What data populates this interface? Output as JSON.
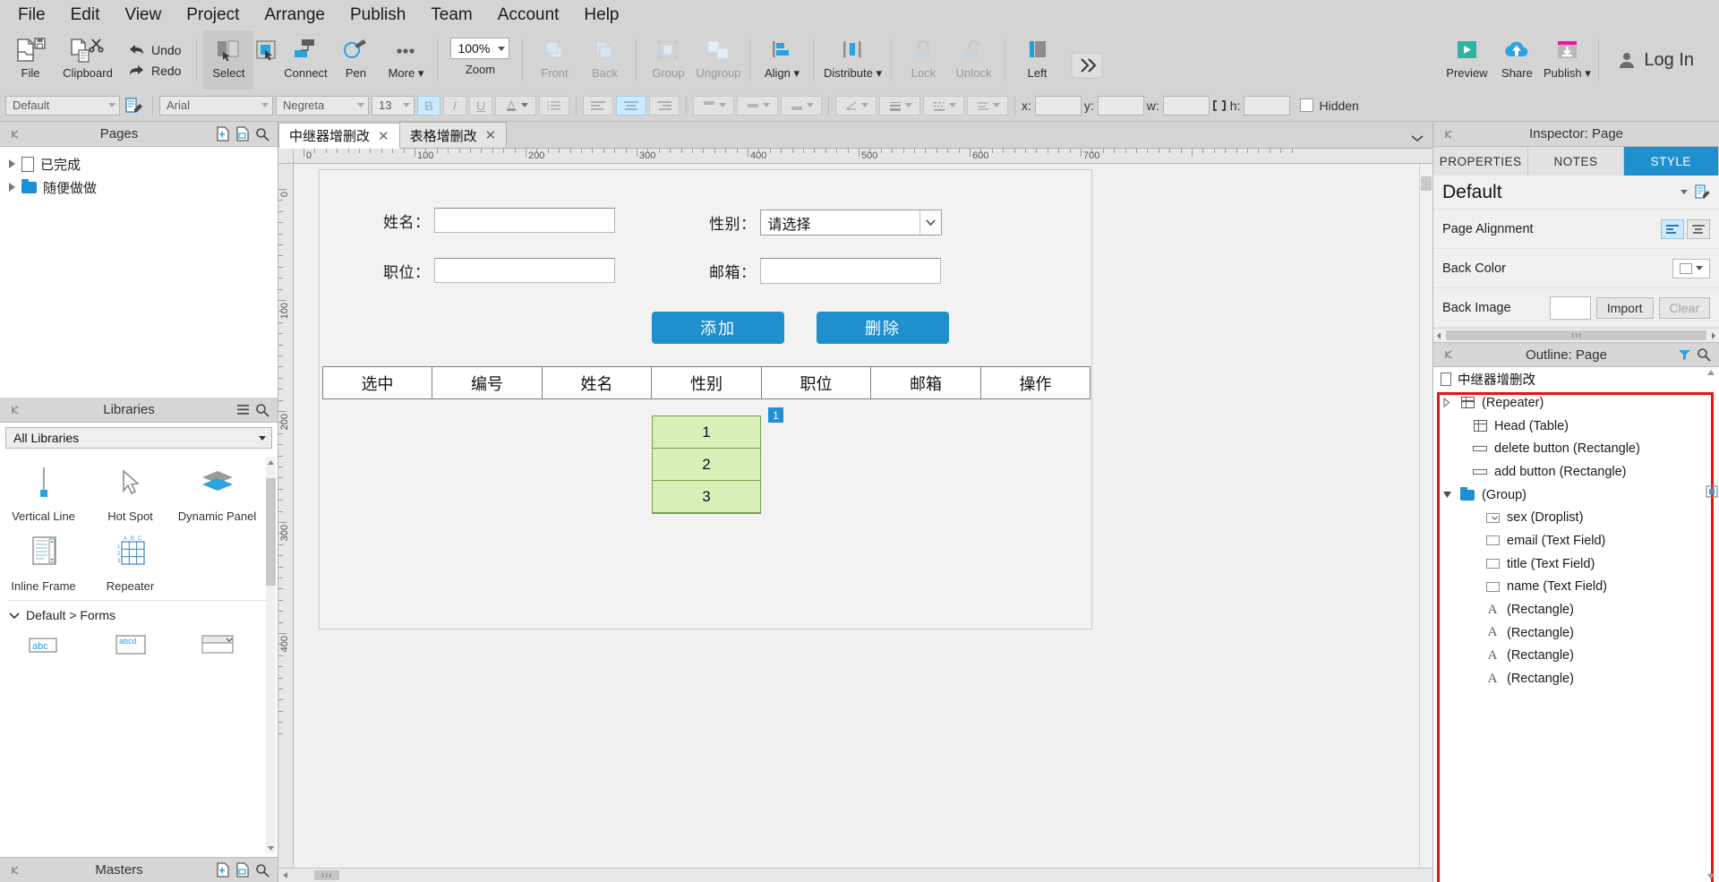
{
  "menu": [
    "File",
    "Edit",
    "View",
    "Project",
    "Arrange",
    "Publish",
    "Team",
    "Account",
    "Help"
  ],
  "toolbar": {
    "file": "File",
    "clipboard": "Clipboard",
    "undo": "Undo",
    "redo": "Redo",
    "select": "Select",
    "connect": "Connect",
    "pen": "Pen",
    "more": "More",
    "zoom_value": "100%",
    "zoom_label": "Zoom",
    "front": "Front",
    "back": "Back",
    "group": "Group",
    "ungroup": "Ungroup",
    "align": "Align",
    "distribute": "Distribute",
    "lock": "Lock",
    "unlock": "Unlock",
    "left": "Left",
    "overflow": "»",
    "preview": "Preview",
    "share": "Share",
    "publish": "Publish",
    "login": "Log In"
  },
  "format": {
    "style_preset": "Default",
    "font_family": "Arial",
    "font_weight": "Negreta",
    "font_size": "13",
    "bold": "B",
    "italic": "I",
    "underline": "U",
    "x_label": "x:",
    "y_label": "y:",
    "w_label": "w:",
    "h_label": "h:",
    "x_value": "",
    "y_value": "",
    "w_value": "",
    "h_value": "",
    "hidden_label": "Hidden"
  },
  "pages": {
    "title": "Pages",
    "items": [
      {
        "label": "已完成",
        "icon": "page-icon"
      },
      {
        "label": "随便做做",
        "icon": "folder-icon"
      }
    ]
  },
  "libraries": {
    "title": "Libraries",
    "selected": "All Libraries",
    "widgets_row1": [
      {
        "label": "Vertical Line",
        "icon": "vertical-line-icon"
      },
      {
        "label": "Hot Spot",
        "icon": "cursor-icon"
      },
      {
        "label": "Dynamic Panel",
        "icon": "layers-icon"
      }
    ],
    "widgets_row2": [
      {
        "label": "Inline Frame",
        "icon": "iframe-icon"
      },
      {
        "label": "Repeater",
        "icon": "repeater-icon"
      }
    ],
    "section": "Default > Forms",
    "widgets_row3": [
      {
        "label": "abc",
        "icon": "textfield-icon"
      },
      {
        "label": "abcd",
        "icon": "textarea-icon"
      },
      {
        "label": "",
        "icon": "droplist-icon"
      }
    ],
    "masters": "Masters"
  },
  "tabs": [
    {
      "label": "中继器增删改",
      "active": true
    },
    {
      "label": "表格增删改",
      "active": false
    }
  ],
  "ruler": {
    "h_labels": [
      "0",
      "100",
      "200",
      "300",
      "400",
      "500",
      "600",
      "700"
    ],
    "v_labels": [
      "0",
      "100",
      "200",
      "300",
      "400"
    ]
  },
  "canvas": {
    "form": {
      "fields": [
        {
          "label": "姓名：",
          "type": "text",
          "value": ""
        },
        {
          "label": "性别：",
          "type": "droplist",
          "value": "请选择"
        },
        {
          "label": "职位：",
          "type": "text",
          "value": ""
        },
        {
          "label": "邮箱：",
          "type": "text",
          "value": ""
        }
      ],
      "buttons": [
        {
          "label": "添加",
          "color": "#1f90cd"
        },
        {
          "label": "删除",
          "color": "#1f90cd"
        }
      ]
    },
    "table_headers": [
      "选中",
      "编号",
      "姓名",
      "性别",
      "职位",
      "邮箱",
      "操作"
    ],
    "repeater": {
      "rows": [
        "1",
        "2",
        "3"
      ],
      "badge": "1",
      "fill": "#d9efb8",
      "border": "#7b9f52"
    }
  },
  "inspector": {
    "title": "Inspector: Page",
    "tabs": [
      {
        "label": "PROPERTIES",
        "active": false
      },
      {
        "label": "NOTES",
        "active": false
      },
      {
        "label": "STYLE",
        "active": true
      }
    ],
    "style_name": "Default",
    "rows": [
      {
        "name": "Page Alignment",
        "control": "align-buttons"
      },
      {
        "name": "Back Color",
        "control": "color-picker"
      },
      {
        "name": "Back Image",
        "control": "image-import"
      }
    ],
    "import_label": "Import",
    "clear_label": "Clear"
  },
  "outline": {
    "title": "Outline: Page",
    "root": "中继器增删改",
    "items": [
      {
        "label": "(Repeater)",
        "icon": "table-icon",
        "indent": 0,
        "expander": "collapsed"
      },
      {
        "label": "Head (Table)",
        "icon": "table-icon",
        "indent": 1,
        "expander": "none"
      },
      {
        "label": "delete button (Rectangle)",
        "icon": "rectangle-icon",
        "indent": 1,
        "expander": "none"
      },
      {
        "label": "add button (Rectangle)",
        "icon": "rectangle-icon",
        "indent": 1,
        "expander": "none"
      },
      {
        "label": "(Group)",
        "icon": "folder-icon",
        "indent": 0,
        "expander": "expanded"
      },
      {
        "label": "sex (Droplist)",
        "icon": "droplist-icon",
        "indent": 2,
        "expander": "none"
      },
      {
        "label": "email (Text Field)",
        "icon": "textfield-icon",
        "indent": 2,
        "expander": "none"
      },
      {
        "label": "title (Text Field)",
        "icon": "textfield-icon",
        "indent": 2,
        "expander": "none"
      },
      {
        "label": "name (Text Field)",
        "icon": "textfield-icon",
        "indent": 2,
        "expander": "none"
      },
      {
        "label": "(Rectangle)",
        "icon": "text-a-icon",
        "indent": 2,
        "expander": "none"
      },
      {
        "label": "(Rectangle)",
        "icon": "text-a-icon",
        "indent": 2,
        "expander": "none"
      },
      {
        "label": "(Rectangle)",
        "icon": "text-a-icon",
        "indent": 2,
        "expander": "none"
      },
      {
        "label": "(Rectangle)",
        "icon": "text-a-icon",
        "indent": 2,
        "expander": "none"
      }
    ],
    "highlight_color": "#e8150f"
  },
  "colors": {
    "accent": "#1f90cd",
    "chrome": "#d4d4d4",
    "panel": "#f0f0f0",
    "repeater_fill": "#d9efb8"
  }
}
